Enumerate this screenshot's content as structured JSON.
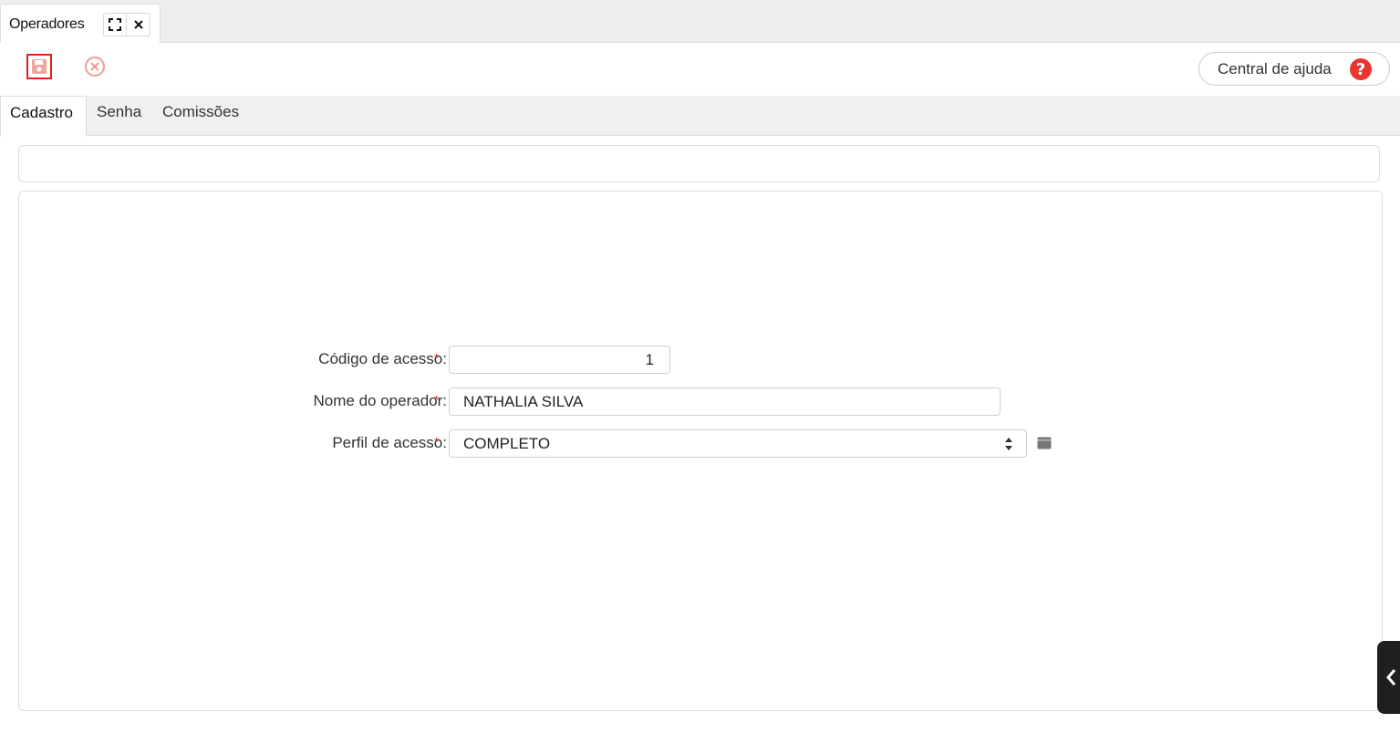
{
  "window_tab": {
    "title": "Operadores",
    "expand_icon": "expand-icon",
    "close_icon": "close-icon"
  },
  "toolbar": {
    "save_icon": "floppy-disk-icon",
    "cancel_icon": "cancel-circle-icon",
    "help_label": "Central de ajuda",
    "help_icon_glyph": "?"
  },
  "section_tabs": [
    {
      "label": "Cadastro",
      "active": true
    },
    {
      "label": "Senha",
      "active": false
    },
    {
      "label": "Comissões",
      "active": false
    }
  ],
  "form": {
    "codigo": {
      "label": "Código de acesso:",
      "required_mark": "*",
      "value": "1"
    },
    "nome": {
      "label": "Nome do operador:",
      "required_mark": "*",
      "value": "NATHALIA SILVA"
    },
    "perfil": {
      "label": "Perfil de acesso:",
      "required_mark": "*",
      "value": "COMPLETO",
      "side_icon": "card-icon"
    }
  },
  "colors": {
    "accent_red": "#e0221e",
    "help_red": "#e8352d",
    "drawer_dark": "#1f1f1f"
  }
}
